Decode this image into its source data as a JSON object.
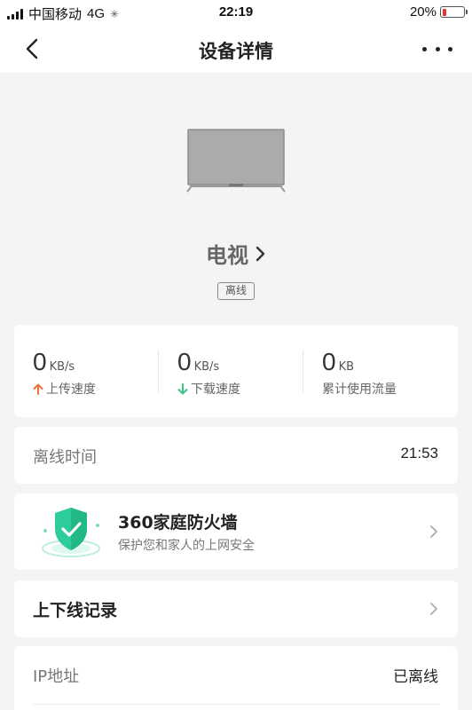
{
  "status_bar": {
    "carrier": "中国移动",
    "network": "4G",
    "time": "22:19",
    "battery_percent": "20%",
    "battery_level": 0.2,
    "battery_color": "#e33333"
  },
  "nav": {
    "title": "设备详情",
    "back_icon": "back-arrow-icon",
    "more_icon": "more-dots-icon"
  },
  "device": {
    "icon": "tv-icon",
    "name": "电视",
    "status": "离线"
  },
  "stats": [
    {
      "value": "0",
      "unit": "KB/s",
      "label": "上传速度",
      "icon": "upload-arrow-icon",
      "icon_color": "#f26b3a"
    },
    {
      "value": "0",
      "unit": "KB/s",
      "label": "下载速度",
      "icon": "download-arrow-icon",
      "icon_color": "#3cc488"
    },
    {
      "value": "0",
      "unit": "KB",
      "label": "累计使用流量"
    }
  ],
  "offline_time": {
    "label": "离线时间",
    "value": "21:53"
  },
  "firewall": {
    "title": "360家庭防火墙",
    "subtitle": "保护您和家人的上网安全",
    "icon": "shield-check-icon",
    "accent": "#2ecc9a"
  },
  "online_records": {
    "label": "上下线记录"
  },
  "ip": {
    "label": "IP地址",
    "value": "已离线"
  }
}
